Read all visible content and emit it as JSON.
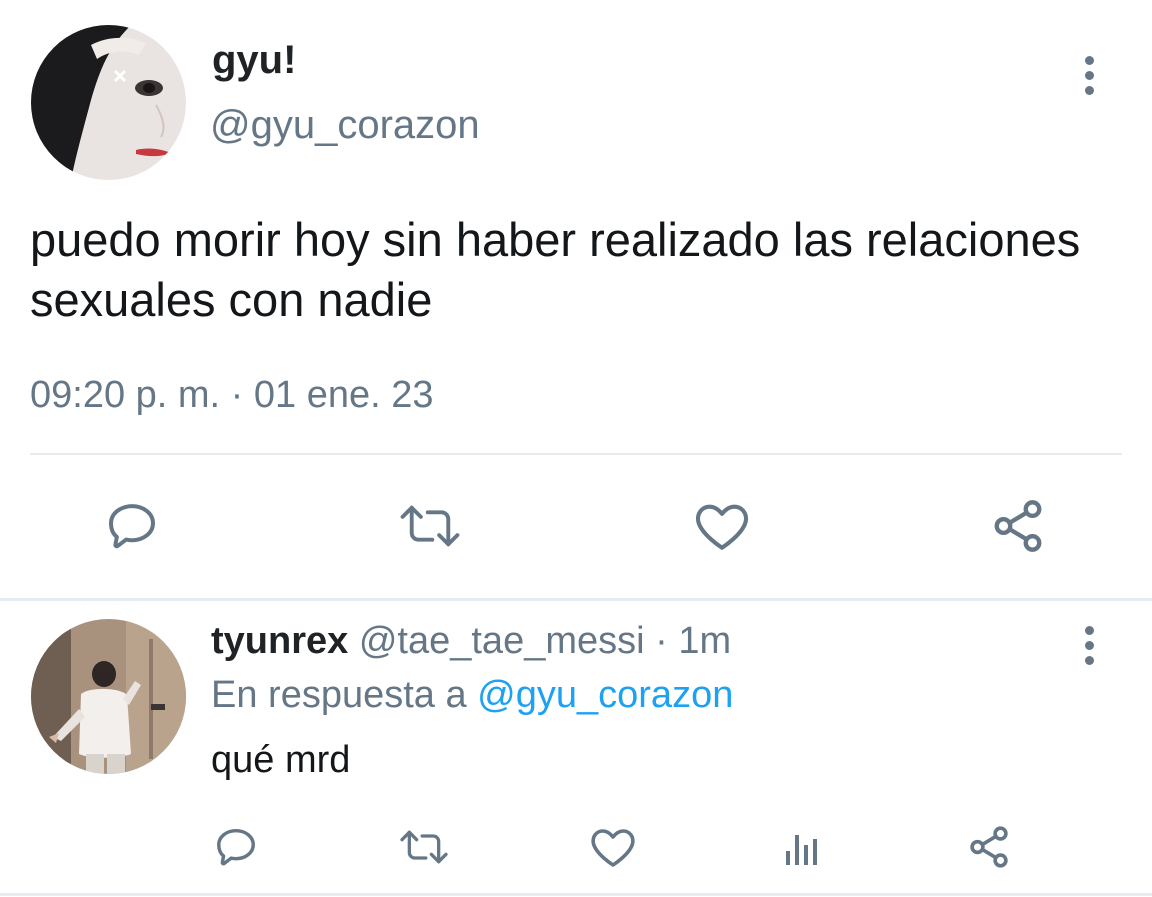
{
  "main_tweet": {
    "display_name": "gyu!",
    "handle": "@gyu_corazon",
    "text": "puedo morir hoy sin haber realizado las relaciones sexuales con nadie",
    "timestamp": "09:20 p. m. · 01 ene. 23",
    "avatar_icon": "user-avatar",
    "more_icon": "more-vertical-icon",
    "actions": [
      "reply-icon",
      "retweet-icon",
      "like-icon",
      "share-icon"
    ]
  },
  "reply_tweet": {
    "display_name": "tyunrex",
    "handle": "@tae_tae_messi",
    "separator": " · ",
    "time_ago": "1m",
    "reply_prefix": "En respuesta a",
    "reply_mention": "@gyu_corazon",
    "text": "qué mrd",
    "avatar_icon": "user-avatar",
    "more_icon": "more-vertical-icon",
    "actions": [
      "reply-icon",
      "retweet-icon",
      "like-icon",
      "analytics-icon",
      "share-icon"
    ]
  },
  "colors": {
    "text_primary": "#14171a",
    "text_secondary": "#657786",
    "link": "#1da1f2",
    "divider": "#e6ecf0"
  }
}
